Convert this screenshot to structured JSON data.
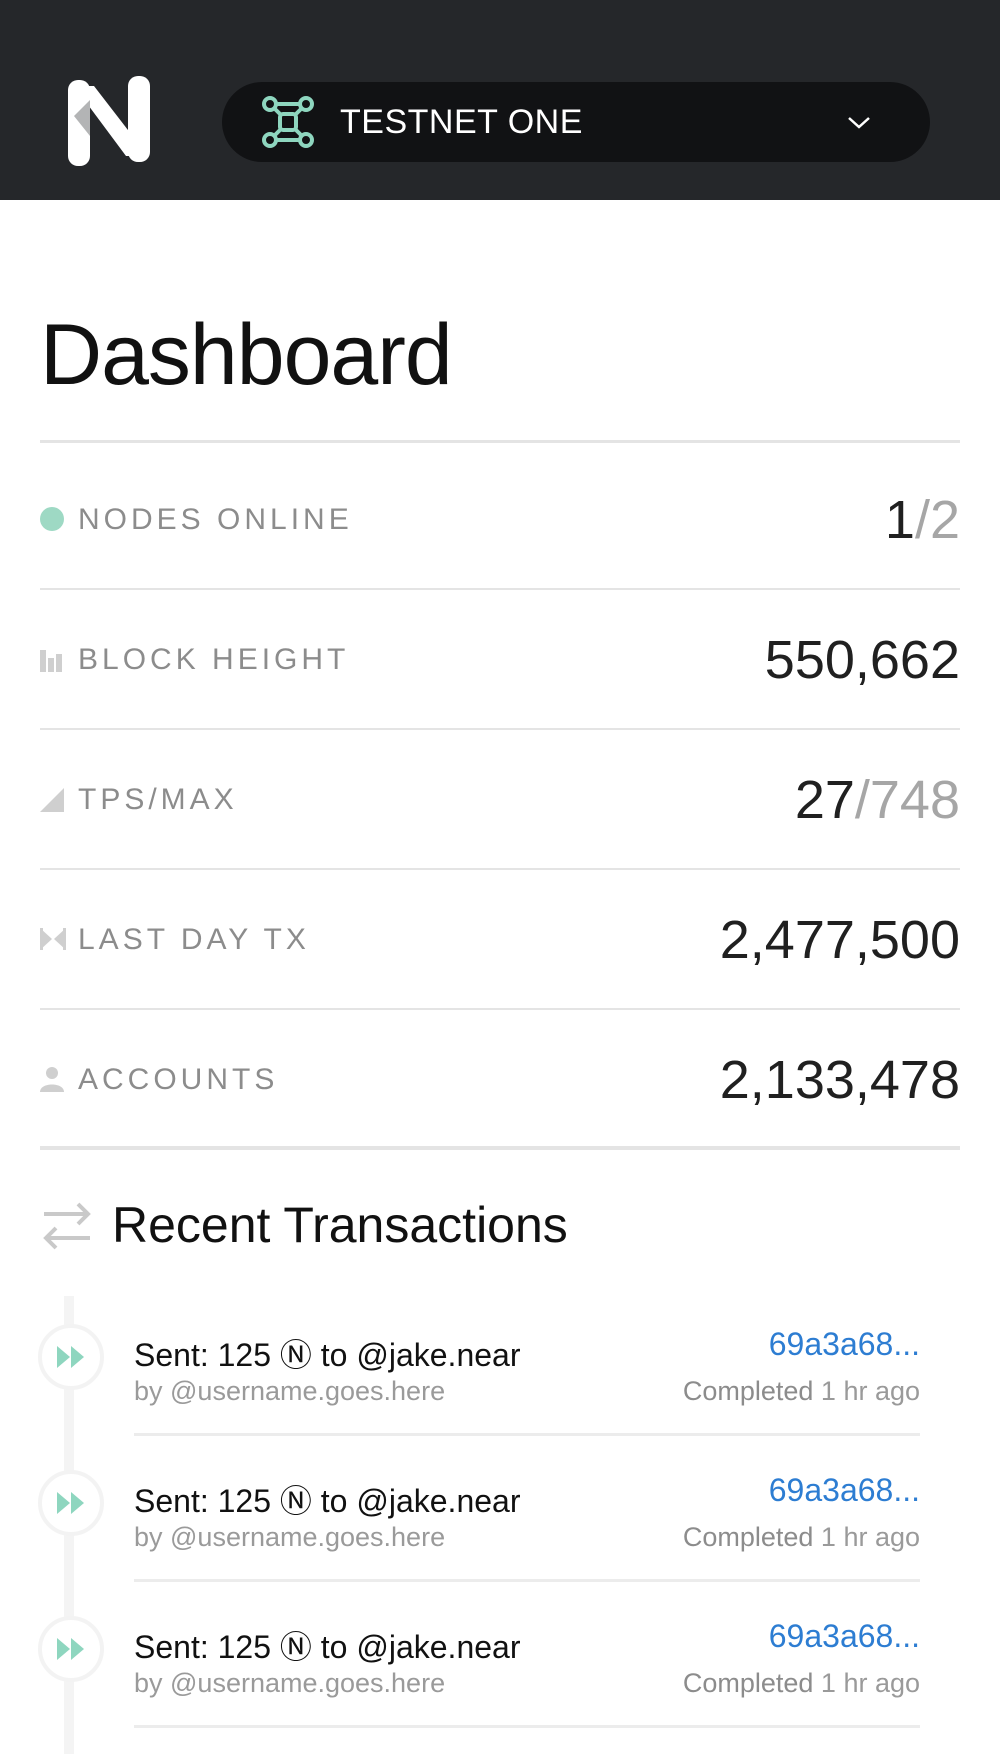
{
  "header": {
    "network_name": "TESTNET ONE",
    "colors": {
      "background": "#25272a",
      "select_bg": "#111214",
      "accent": "#8ed6bf"
    }
  },
  "page_title": "Dashboard",
  "stats": [
    {
      "icon": "status-dot-icon",
      "label": "NODES ONLINE",
      "value": "1",
      "value_secondary": "/2"
    },
    {
      "icon": "bar-chart-icon",
      "label": "BLOCK HEIGHT",
      "value": "550,662"
    },
    {
      "icon": "triangle-icon",
      "label": "TPS/MAX",
      "value": "27",
      "value_secondary": "/748"
    },
    {
      "icon": "bowtie-icon",
      "label": "LAST DAY TX",
      "value": "2,477,500"
    },
    {
      "icon": "person-icon",
      "label": "ACCOUNTS",
      "value": "2,133,478"
    }
  ],
  "recent": {
    "title": "Recent Transactions",
    "transactions": [
      {
        "summary": "Sent: 125 Ⓝ to @jake.near",
        "by": "by @username.goes.here",
        "hash": "69a3a68...",
        "status": "Completed",
        "time": "1 hr ago"
      },
      {
        "summary": "Sent: 125 Ⓝ to @jake.near",
        "by": "by @username.goes.here",
        "hash": "69a3a68...",
        "status": "Completed",
        "time": "1 hr ago"
      },
      {
        "summary": "Sent: 125 Ⓝ to @jake.near",
        "by": "by @username.goes.here",
        "hash": "69a3a68...",
        "status": "Completed",
        "time": "1 hr ago"
      }
    ]
  }
}
